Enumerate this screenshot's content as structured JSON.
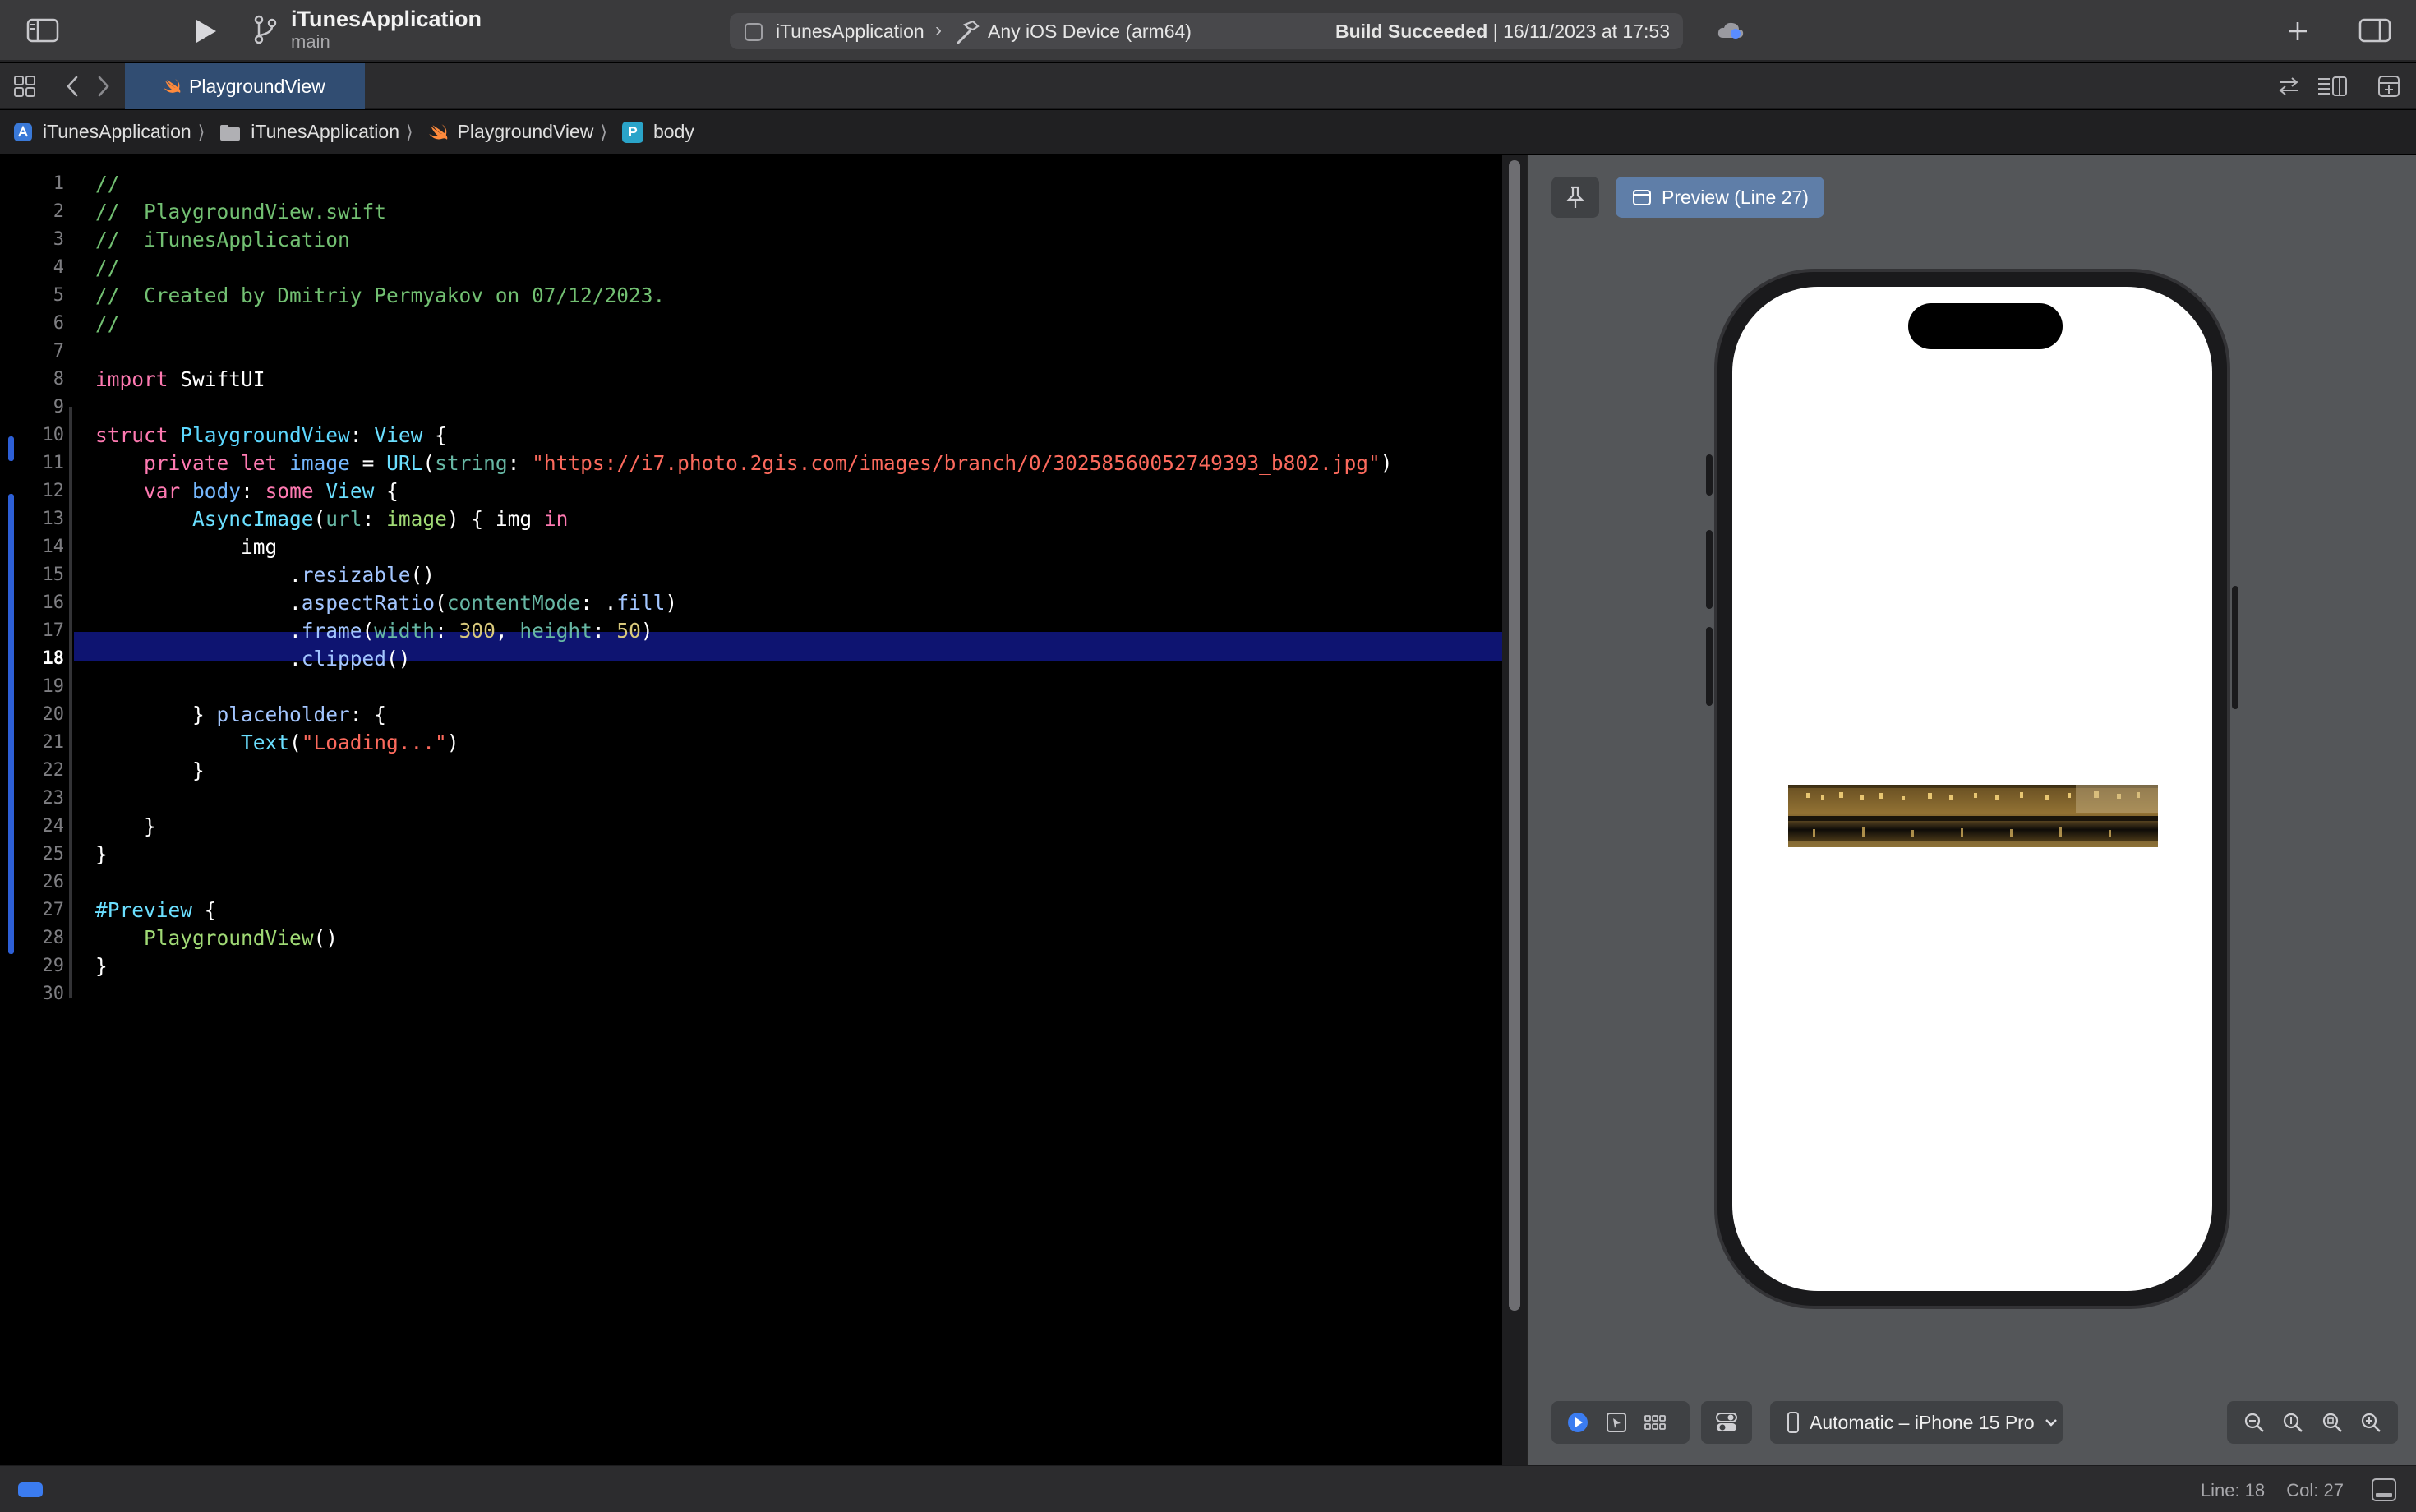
{
  "toolbar": {
    "project_name": "iTunesApplication",
    "branch": "main",
    "scheme": "iTunesApplication",
    "device": "Any iOS Device (arm64)",
    "build_status_bold": "Build Succeeded",
    "build_status_rest": "| 16/11/2023 at 17:53"
  },
  "tabs": [
    {
      "label": "PlaygroundView",
      "active": true
    }
  ],
  "breadcrumb": {
    "project": "iTunesApplication",
    "folder": "iTunesApplication",
    "file": "PlaygroundView",
    "symbol_badge": "P",
    "symbol": "body"
  },
  "editor": {
    "current_line": 18,
    "lines": [
      {
        "n": "1",
        "segs": [
          {
            "t": "//",
            "c": "comment"
          }
        ]
      },
      {
        "n": "2",
        "segs": [
          {
            "t": "//  PlaygroundView.swift",
            "c": "comment"
          }
        ]
      },
      {
        "n": "3",
        "segs": [
          {
            "t": "//  iTunesApplication",
            "c": "comment"
          }
        ]
      },
      {
        "n": "4",
        "segs": [
          {
            "t": "//",
            "c": "comment"
          }
        ]
      },
      {
        "n": "5",
        "segs": [
          {
            "t": "//  Created by Dmitriy Permyakov on 07/12/2023.",
            "c": "comment"
          }
        ]
      },
      {
        "n": "6",
        "segs": [
          {
            "t": "//",
            "c": "comment"
          }
        ]
      },
      {
        "n": "7",
        "segs": []
      },
      {
        "n": "8",
        "segs": [
          {
            "t": "import",
            "c": "kw"
          },
          {
            "t": " SwiftUI",
            "c": "plain"
          }
        ]
      },
      {
        "n": "9",
        "segs": []
      },
      {
        "n": "10",
        "segs": [
          {
            "t": "struct",
            "c": "kw"
          },
          {
            "t": " ",
            "c": "plain"
          },
          {
            "t": "PlaygroundView",
            "c": "typedecl"
          },
          {
            "t": ": ",
            "c": "plain"
          },
          {
            "t": "View",
            "c": "type"
          },
          {
            "t": " {",
            "c": "plain"
          }
        ]
      },
      {
        "n": "11",
        "segs": [
          {
            "t": "    ",
            "c": "plain"
          },
          {
            "t": "private",
            "c": "kw"
          },
          {
            "t": " ",
            "c": "plain"
          },
          {
            "t": "let",
            "c": "kw"
          },
          {
            "t": " ",
            "c": "plain"
          },
          {
            "t": "image",
            "c": "prop"
          },
          {
            "t": " = ",
            "c": "plain"
          },
          {
            "t": "URL",
            "c": "type"
          },
          {
            "t": "(",
            "c": "plain"
          },
          {
            "t": "string",
            "c": "fn"
          },
          {
            "t": ": ",
            "c": "plain"
          },
          {
            "t": "\"https://i7.photo.2gis.com/images/branch/0/30258560052749393_b802.jpg\"",
            "c": "str"
          },
          {
            "t": ")",
            "c": "plain"
          }
        ]
      },
      {
        "n": "12",
        "segs": [
          {
            "t": "    ",
            "c": "plain"
          },
          {
            "t": "var",
            "c": "kw"
          },
          {
            "t": " ",
            "c": "plain"
          },
          {
            "t": "body",
            "c": "prop"
          },
          {
            "t": ": ",
            "c": "plain"
          },
          {
            "t": "some",
            "c": "kw"
          },
          {
            "t": " ",
            "c": "plain"
          },
          {
            "t": "View",
            "c": "type"
          },
          {
            "t": " {",
            "c": "plain"
          }
        ]
      },
      {
        "n": "13",
        "segs": [
          {
            "t": "        ",
            "c": "plain"
          },
          {
            "t": "AsyncImage",
            "c": "type"
          },
          {
            "t": "(",
            "c": "plain"
          },
          {
            "t": "url",
            "c": "fn"
          },
          {
            "t": ": ",
            "c": "plain"
          },
          {
            "t": "image",
            "c": "label"
          },
          {
            "t": ") { img ",
            "c": "plain"
          },
          {
            "t": "in",
            "c": "kw"
          }
        ]
      },
      {
        "n": "14",
        "segs": [
          {
            "t": "            img",
            "c": "plain"
          }
        ]
      },
      {
        "n": "15",
        "segs": [
          {
            "t": "                .",
            "c": "plain"
          },
          {
            "t": "resizable",
            "c": "method"
          },
          {
            "t": "()",
            "c": "plain"
          }
        ]
      },
      {
        "n": "16",
        "segs": [
          {
            "t": "                .",
            "c": "plain"
          },
          {
            "t": "aspectRatio",
            "c": "method"
          },
          {
            "t": "(",
            "c": "plain"
          },
          {
            "t": "contentMode",
            "c": "fn"
          },
          {
            "t": ": .",
            "c": "plain"
          },
          {
            "t": "fill",
            "c": "method"
          },
          {
            "t": ")",
            "c": "plain"
          }
        ]
      },
      {
        "n": "17",
        "segs": [
          {
            "t": "                .",
            "c": "plain"
          },
          {
            "t": "frame",
            "c": "method"
          },
          {
            "t": "(",
            "c": "plain"
          },
          {
            "t": "width",
            "c": "fn"
          },
          {
            "t": ": ",
            "c": "plain"
          },
          {
            "t": "300",
            "c": "num"
          },
          {
            "t": ", ",
            "c": "plain"
          },
          {
            "t": "height",
            "c": "fn"
          },
          {
            "t": ": ",
            "c": "plain"
          },
          {
            "t": "50",
            "c": "num"
          },
          {
            "t": ")",
            "c": "plain"
          }
        ]
      },
      {
        "n": "18",
        "segs": [
          {
            "t": "                .",
            "c": "plain"
          },
          {
            "t": "clipped",
            "c": "method"
          },
          {
            "t": "()",
            "c": "plain"
          }
        ]
      },
      {
        "n": "19",
        "segs": []
      },
      {
        "n": "20",
        "segs": [
          {
            "t": "        } ",
            "c": "plain"
          },
          {
            "t": "placeholder",
            "c": "method"
          },
          {
            "t": ": {",
            "c": "plain"
          }
        ]
      },
      {
        "n": "21",
        "segs": [
          {
            "t": "            ",
            "c": "plain"
          },
          {
            "t": "Text",
            "c": "type"
          },
          {
            "t": "(",
            "c": "plain"
          },
          {
            "t": "\"Loading...\"",
            "c": "str"
          },
          {
            "t": ")",
            "c": "plain"
          }
        ]
      },
      {
        "n": "22",
        "segs": [
          {
            "t": "        }",
            "c": "plain"
          }
        ]
      },
      {
        "n": "23",
        "segs": []
      },
      {
        "n": "24",
        "segs": [
          {
            "t": "    }",
            "c": "plain"
          }
        ]
      },
      {
        "n": "25",
        "segs": [
          {
            "t": "}",
            "c": "plain"
          }
        ]
      },
      {
        "n": "26",
        "segs": []
      },
      {
        "n": "27",
        "segs": [
          {
            "t": "#Preview",
            "c": "macro"
          },
          {
            "t": " {",
            "c": "plain"
          }
        ]
      },
      {
        "n": "28",
        "segs": [
          {
            "t": "    ",
            "c": "plain"
          },
          {
            "t": "PlaygroundView",
            "c": "label"
          },
          {
            "t": "()",
            "c": "plain"
          }
        ]
      },
      {
        "n": "29",
        "segs": [
          {
            "t": "}",
            "c": "plain"
          }
        ]
      },
      {
        "n": "30",
        "segs": []
      }
    ]
  },
  "canvas": {
    "preview_label": "Preview (Line 27)",
    "device_picker": "Automatic – iPhone 15 Pro"
  },
  "status": {
    "line": "Line: 18",
    "col": "Col: 27"
  },
  "colors": {
    "accent": "#3b7cf0",
    "current_line_highlight": "#0e1471",
    "active_tab": "#314d72",
    "preview_chip": "#5f7ea8"
  }
}
